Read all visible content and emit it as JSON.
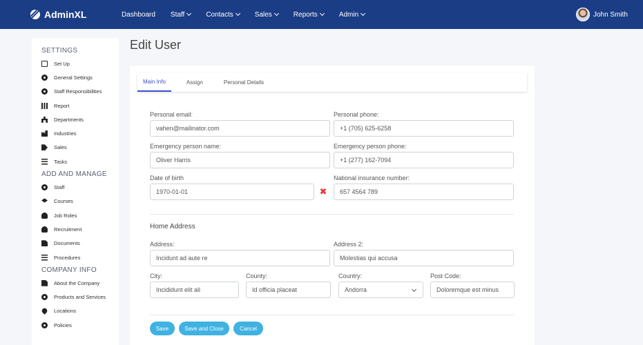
{
  "app": {
    "brand": "AdminXL"
  },
  "nav": [
    {
      "label": "Dashboard",
      "dropdown": false
    },
    {
      "label": "Staff",
      "dropdown": true
    },
    {
      "label": "Contacts",
      "dropdown": true
    },
    {
      "label": "Sales",
      "dropdown": true
    },
    {
      "label": "Reports",
      "dropdown": true
    },
    {
      "label": "Admin",
      "dropdown": true
    }
  ],
  "user": {
    "name": "John Smith"
  },
  "sidebar": {
    "sections": [
      {
        "title": "SETTINGS",
        "items": [
          {
            "label": "Set Up",
            "icon": "setup-icon"
          },
          {
            "label": "General Settings",
            "icon": "gear-icon"
          },
          {
            "label": "Staff Responsibilities",
            "icon": "gear-icon"
          },
          {
            "label": "Report",
            "icon": "bar-chart-icon"
          },
          {
            "label": "Departments",
            "icon": "sitemap-icon"
          },
          {
            "label": "Industries",
            "icon": "industry-icon"
          },
          {
            "label": "Sales",
            "icon": "tag-icon"
          },
          {
            "label": "Tasks",
            "icon": "list-icon"
          }
        ]
      },
      {
        "title": "ADD AND MANAGE",
        "items": [
          {
            "label": "Staff",
            "icon": "gear-icon"
          },
          {
            "label": "Courses",
            "icon": "graduation-cap-icon"
          },
          {
            "label": "Job Roles",
            "icon": "user-cog-icon"
          },
          {
            "label": "Recruitment",
            "icon": "users-icon"
          },
          {
            "label": "Documents",
            "icon": "document-icon"
          },
          {
            "label": "Procedures",
            "icon": "list-icon"
          }
        ]
      },
      {
        "title": "COMPANY INFO",
        "items": [
          {
            "label": "About the Company",
            "icon": "building-icon"
          },
          {
            "label": "Products and Services",
            "icon": "gears-icon"
          },
          {
            "label": "Locations",
            "icon": "map-pin-icon"
          },
          {
            "label": "Policies",
            "icon": "gear-icon"
          }
        ]
      }
    ]
  },
  "page": {
    "title": "Edit User"
  },
  "tabs": [
    {
      "label": "Main Info",
      "active": true
    },
    {
      "label": "Assign",
      "active": false
    },
    {
      "label": "Personal Details",
      "active": false
    }
  ],
  "form": {
    "personal_email": {
      "label": "Personal email:",
      "value": "vahen@mailinator.com"
    },
    "personal_phone": {
      "label": "Personal phone:",
      "value": "+1 (705) 625-6258"
    },
    "emergency_name": {
      "label": "Emergency person name:",
      "value": "Oliver Harris"
    },
    "emergency_phone": {
      "label": "Emergency person phone:",
      "value": "+1 (277) 162-7094"
    },
    "dob": {
      "label": "Date of birth",
      "value": "1970-01-01"
    },
    "ni_number": {
      "label": "National insurance number:",
      "value": "657 4564 789"
    },
    "home_address_title": "Home Address",
    "address": {
      "label": "Address:",
      "value": "Incidunt ad aute re"
    },
    "address2": {
      "label": "Address 2:",
      "value": "Molestias qui accusa"
    },
    "city": {
      "label": "City:",
      "value": "Incididunt elit ali"
    },
    "county": {
      "label": "County:",
      "value": "Id officia placeat"
    },
    "country": {
      "label": "Country:",
      "value": "Andorra"
    },
    "postcode": {
      "label": "Post Code:",
      "value": "Doloremque est minus"
    }
  },
  "buttons": {
    "save": "Save",
    "save_close": "Save and Close",
    "cancel": "Cancel"
  },
  "colors": {
    "topbar": "#1b3d86",
    "accent": "#3b4fd1",
    "button": "#3fb2e2",
    "clear": "#e53935"
  }
}
